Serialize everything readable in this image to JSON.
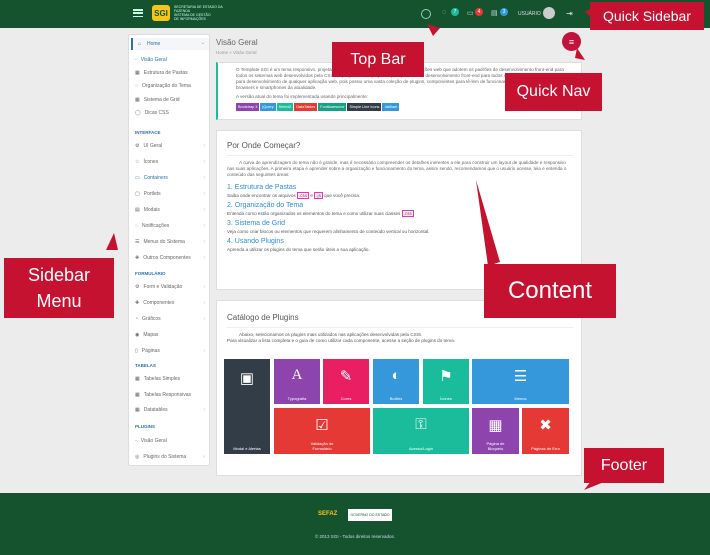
{
  "topbar": {
    "logo_text": "SGI",
    "logo_sub": "SECRETARIA DE ESTADO DA FAZENDA\nSISTEMA DE GESTÃO\nDE INFORMAÇÕES",
    "user": "USUÁRIO",
    "badges": [
      "7",
      "4",
      "3"
    ]
  },
  "sidebar": {
    "home": "Home",
    "home_items": [
      "Visão Geral",
      "Estrutura de Pastas",
      "Organização do Tema",
      "Sistema de Grid",
      "Dicas CSS"
    ],
    "sec_interface": "INTERFACE",
    "interface_items": [
      "UI Geral",
      "Ícones",
      "Containers",
      "Portlets",
      "Modais",
      "Notificações",
      "Menus do Sistema",
      "Outros Componentes"
    ],
    "sec_formulario": "FORMULÁRIO",
    "form_items": [
      "Form e Validação",
      "Componentes",
      "Gráficos",
      "Mapas",
      "Páginas"
    ],
    "sec_tabelas": "TABELAS",
    "table_items": [
      "Tabelas Simples",
      "Tabelas Responsivas",
      "Datatables"
    ],
    "sec_plugins": "PLUGINS",
    "plugin_items": [
      "Visão Geral",
      "Plugins do Sistema"
    ]
  },
  "header": {
    "title": "Visão Geral",
    "breadcrumb_home": "Home",
    "breadcrumb_current": "Visão Geral"
  },
  "intro": {
    "p1": "O Template SGI é um tema responsivo, projetado e desenvolvido para construção de aplicações web que adotem os padrões de desenvolvimento front-end para todos os sistemas web desenvolvidos pela CSIS. O projeto é uma proposta para padrões de desenvolvimento front-end para todos os sistemas, e pode ser usado para desenvolvimento de qualquer aplicação web, pois possui uma vasta coleção de plugins, componentes para tê-lem de funcionar perfeitamente nos principais browsers e smartphones da atualidade.",
    "p2": "A versão atual do tema foi implementada usando principalmente:",
    "tags": [
      "Bootstrap 3",
      "jQuery",
      "Select2",
      "DataTables",
      "FontAwesome",
      "Simple Line Icons",
      "Jstitlant"
    ]
  },
  "start": {
    "title": "Por Onde Começar?",
    "p1": "A curva de aprendizagem do tema não é grande, mas é necessário compreender os detalhes inerentes a ele para construir um layout de qualidade e responsivo nas suas aplicações. A primeira etapa é aprender sobre a organização e funcionamento do tema, assim sendo, recomendamos que o usuário acesse, leia e entenda o conteúdo das seguintes áreas:",
    "s1": "1. Estrutura de Pastas",
    "s1t": "Saiba onde encontrar os arquivos",
    "s1c1": ".css",
    "s1c2": ".js",
    "s1t2": "que você precisa.",
    "s2": "2. Organização do Tema",
    "s2t": "Entenda como estão organizados os elementos do tema e como utilizar suas classes",
    "s2c": ".css",
    "s3": "3. Sistema de Grid",
    "s3t": "Veja como criar blocos ou elementos que requerem alinhamento de conteúdo vertical ou horizontal.",
    "s4": "4. Usando Plugins",
    "s4t": "Aprenda a utilizar os plugins do tema que serão úteis a sua aplicação."
  },
  "catalog": {
    "title": "Catálogo de Plugins",
    "p1": "Abaixo, selecionamos os plugins mais utilizados nas aplicações desenvolvidas pela CSIS.",
    "p2": "Para visualizar a lista completa e o guia de como utilizar cada componente, acesse a seção de plugins do tema.",
    "tiles": [
      "Modal e Alertas",
      "Typografia",
      "Cores",
      "Botões",
      "Ícones",
      "Menus",
      "Validação de Formulário",
      "Acesso/Login",
      "Página de Bloqueio",
      "Páginas de Erro"
    ]
  },
  "footer": {
    "logo1": "SEFAZ",
    "logo2": "GOVERNO DO ESTADO",
    "copyright": "© 2013 SGI - Todos direitos reservados."
  },
  "callouts": {
    "quick_sidebar": "Quick Sidebar",
    "top_bar": "Top Bar",
    "quick_nav": "Quick Nav",
    "sidebar_menu": "Sidebar\nMenu",
    "content": "Content",
    "footer": "Footer"
  },
  "colors": {
    "topbar": "#14532d",
    "callout": "#c41230",
    "tile_dark": "#333d47",
    "tile_purple": "#8e44ad",
    "tile_pink": "#e91e63",
    "tile_teal": "#1abc9c",
    "tile_blue": "#3498db",
    "tile_red": "#e53935"
  }
}
